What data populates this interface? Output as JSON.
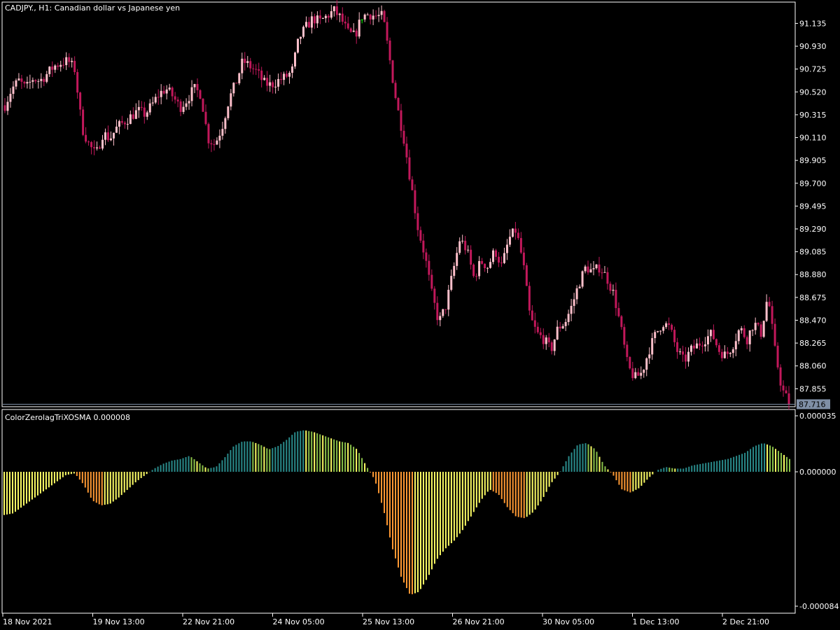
{
  "header": {
    "symbol_label": "CADJPY., H1:  Canadian dollar vs Japanese yen"
  },
  "indicator": {
    "label": "ColorZerolagTriXOSMA 0.000008"
  },
  "colors": {
    "background": "#000000",
    "frame": "#ffffff",
    "bear_candle": "#c2185b",
    "bull_candle": "#ffc0cb",
    "bull_wick_special": "#00ff00",
    "price_line": "#7f8fa6",
    "price_box": "#7f8fa6",
    "osc_deep_pos": "#2a8c8c",
    "osc_mid_pos": "#8bc34a",
    "osc_light": "#ffff66",
    "osc_orange": "#ff9933"
  },
  "chart_data": [
    {
      "type": "candlestick",
      "name": "CADJPY., H1",
      "ylim": [
        87.7,
        91.32
      ],
      "yticks": [
        "91.135",
        "90.930",
        "90.725",
        "90.520",
        "90.315",
        "90.110",
        "89.905",
        "89.700",
        "89.495",
        "89.290",
        "89.085",
        "88.880",
        "88.675",
        "88.470",
        "88.265",
        "88.060",
        "87.855"
      ],
      "ytick_values": [
        91.135,
        90.93,
        90.725,
        90.52,
        90.315,
        90.11,
        89.905,
        89.7,
        89.495,
        89.29,
        89.085,
        88.88,
        88.675,
        88.47,
        88.265,
        88.06,
        87.855
      ],
      "current_price": "87.716",
      "current_price_value": 87.716,
      "xlabels": [
        "18 Nov 2021",
        "19 Nov 13:00",
        "22 Nov 21:00",
        "24 Nov 05:00",
        "25 Nov 13:00",
        "26 Nov 21:00",
        "30 Nov 05:00",
        "1 Dec 13:00",
        "2 Dec 21:00"
      ],
      "close_path": [
        90.4,
        90.55,
        90.62,
        90.55,
        90.64,
        90.62,
        90.68,
        90.75,
        90.78,
        90.8,
        90.72,
        90.2,
        90.05,
        89.95,
        90.15,
        90.1,
        90.2,
        90.25,
        90.3,
        90.35,
        90.32,
        90.4,
        90.5,
        90.55,
        90.48,
        90.38,
        90.45,
        90.55,
        90.5,
        90.1,
        90.05,
        90.2,
        90.45,
        90.6,
        90.8,
        90.75,
        90.7,
        90.6,
        90.58,
        90.62,
        90.65,
        90.7,
        91.0,
        91.1,
        91.18,
        91.15,
        91.2,
        91.25,
        91.18,
        91.05,
        91.02,
        91.2,
        91.22,
        91.2,
        91.2,
        90.8,
        90.4,
        90.1,
        89.7,
        89.3,
        89.05,
        88.7,
        88.45,
        88.6,
        88.9,
        89.2,
        89.1,
        88.85,
        89.0,
        88.95,
        89.1,
        88.95,
        89.2,
        89.28,
        89.0,
        88.5,
        88.35,
        88.3,
        88.2,
        88.4,
        88.45,
        88.6,
        88.8,
        88.95,
        88.9,
        88.95,
        88.85,
        88.7,
        88.4,
        88.05,
        87.95,
        88.0,
        88.2,
        88.35,
        88.45,
        88.4,
        88.2,
        88.1,
        88.2,
        88.25,
        88.3,
        88.35,
        88.2,
        88.15,
        88.25,
        88.4,
        88.3,
        88.45,
        88.35,
        88.7,
        88.2,
        87.85,
        87.73
      ]
    },
    {
      "type": "bar",
      "name": "ColorZerolagTriXOSMA",
      "ylim": [
        -8.4e-05,
        3.5e-05
      ],
      "yticks": [
        "0.000035",
        "0.000000",
        "-0.000084"
      ],
      "ytick_values": [
        3.5e-05,
        0,
        -8.4e-05
      ],
      "last_value": "0.000008",
      "value_path": [
        -2.7e-05,
        -2.6e-05,
        -2.2e-05,
        -1.8e-05,
        -1.4e-05,
        -1e-05,
        -6e-06,
        -2e-06,
        -1e-06,
        -8e-06,
        -1.8e-05,
        -2.1e-05,
        -2e-05,
        -1.6e-05,
        -1.1e-05,
        -6e-06,
        -2e-06,
        2e-06,
        5e-06,
        7e-06,
        8e-06,
        1e-05,
        6e-06,
        2e-06,
        3e-06,
        9e-06,
        1.6e-05,
        1.9e-05,
        1.9e-05,
        1.7e-05,
        1.4e-05,
        1.6e-05,
        2e-05,
        2.5e-05,
        2.6e-05,
        2.5e-05,
        2.3e-05,
        2.1e-05,
        1.9e-05,
        1.8e-05,
        1.4e-05,
        4e-06,
        -5e-06,
        -2.4e-05,
        -4.8e-05,
        -6.6e-05,
        -7.7e-05,
        -7.5e-05,
        -6.6e-05,
        -5.5e-05,
        -4.8e-05,
        -4.3e-05,
        -3.6e-05,
        -2.7e-05,
        -1.8e-05,
        -1.1e-05,
        -1.4e-05,
        -2.2e-05,
        -2.8e-05,
        -2.9e-05,
        -2.5e-05,
        -1.7e-05,
        -7e-06,
        0.0,
        1e-05,
        1.7e-05,
        1.8e-05,
        1.4e-05,
        4e-06,
        -2e-06,
        -1.1e-05,
        -1.3e-05,
        -1e-05,
        -4e-06,
        1e-06,
        3e-06,
        2e-06,
        2e-06,
        4e-06,
        5e-06,
        6e-06,
        7e-06,
        8e-06,
        1e-05,
        1.2e-05,
        1.6e-05,
        1.8e-05,
        1.6e-05,
        1.2e-05,
        8e-06
      ]
    }
  ]
}
